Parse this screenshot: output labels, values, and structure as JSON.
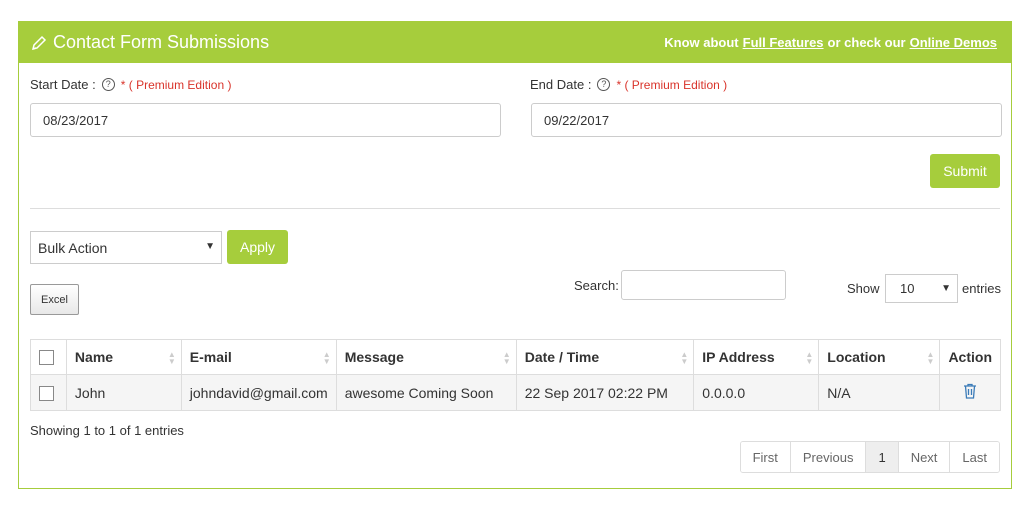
{
  "header": {
    "title": "Contact Form Submissions",
    "know_about": "Know about",
    "full_features": "Full Features",
    "or_check": "or check our",
    "online_demos": "Online Demos"
  },
  "filters": {
    "start_label": "Start Date :",
    "end_label": "End Date :",
    "premium": "* ( Premium Edition )",
    "help_glyph": "?",
    "start_value": "08/23/2017",
    "end_value": "09/22/2017",
    "submit_label": "Submit"
  },
  "bulk": {
    "selected": "Bulk Action",
    "apply_label": "Apply"
  },
  "excel_label": "Excel",
  "search": {
    "label": "Search:",
    "value": ""
  },
  "show": {
    "label": "Show",
    "value": "10",
    "suffix": "entries"
  },
  "table": {
    "columns": [
      "Name",
      "E-mail",
      "Message",
      "Date / Time",
      "IP Address",
      "Location",
      "Action"
    ],
    "rows": [
      {
        "name": "John",
        "email": "johndavid@gmail.com",
        "message": "awesome Coming Soon",
        "datetime": "22 Sep 2017 02:22 PM",
        "ip": "0.0.0.0",
        "location": "N/A"
      }
    ]
  },
  "info": "Showing 1 to 1 of 1 entries",
  "pagination": {
    "first": "First",
    "previous": "Previous",
    "current": "1",
    "next": "Next",
    "last": "Last"
  },
  "colors": {
    "accent": "#a6cd3c",
    "premium": "#d9342b",
    "delete_icon": "#3a7bb8"
  },
  "icons": {
    "title": "pencil-icon",
    "help": "help-circle-icon",
    "delete": "trash-icon"
  }
}
